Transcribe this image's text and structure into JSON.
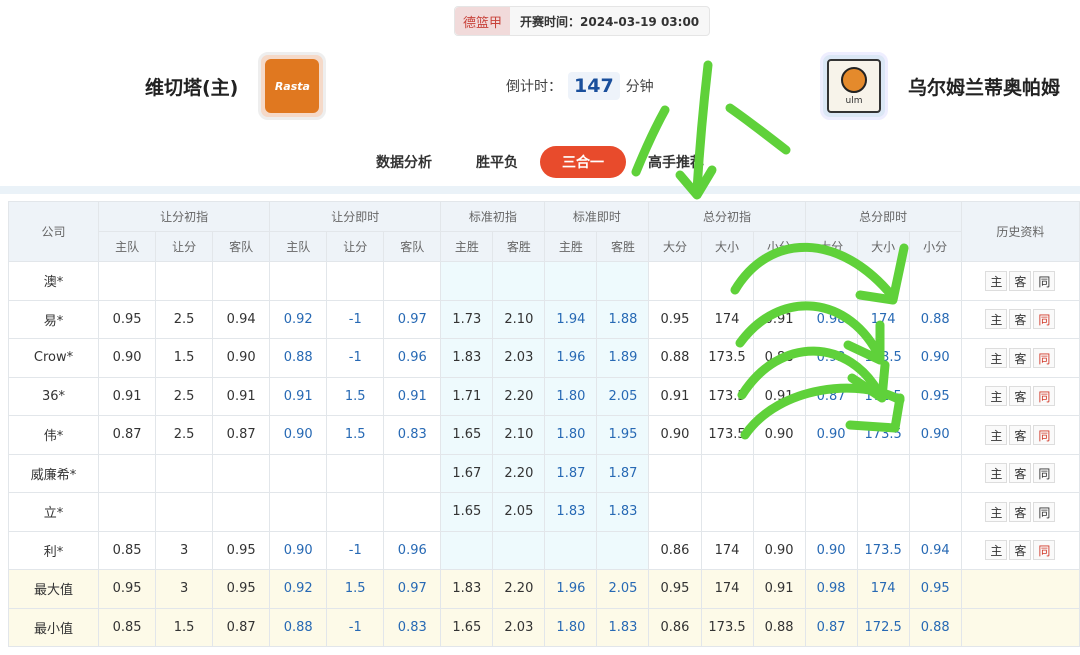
{
  "header": {
    "league": "德篮甲",
    "start_time": "开赛时间：2024-03-19 03:00"
  },
  "home": {
    "name": "维切塔(主)",
    "logo_text": "Rasta"
  },
  "away": {
    "name": "乌尔姆兰蒂奥帕姆",
    "logo_text": "ulm"
  },
  "countdown": {
    "label": "倒计时：",
    "value": "147",
    "unit": "分钟"
  },
  "tabs": [
    "数据分析",
    "胜平负",
    "三合一",
    "高手推荐"
  ],
  "table": {
    "group_headers": [
      "公司",
      "让分初指",
      "让分即时",
      "标准初指",
      "标准即时",
      "总分初指",
      "总分即时",
      "历史资料"
    ],
    "sub_headers": [
      "主队",
      "让分",
      "客队",
      "主队",
      "让分",
      "客队",
      "主胜",
      "客胜",
      "主胜",
      "客胜",
      "大分",
      "大小",
      "小分",
      "大分",
      "大小",
      "小分"
    ],
    "rows": [
      {
        "company": "澳*",
        "v": [
          "",
          "",
          "",
          "",
          "",
          "",
          "",
          "",
          "",
          "",
          "",
          "",
          "",
          "",
          "",
          ""
        ],
        "same_red": false
      },
      {
        "company": "易*",
        "v": [
          "0.95",
          "2.5",
          "0.94",
          "0.92",
          "-1",
          "0.97",
          "1.73",
          "2.10",
          "1.94",
          "1.88",
          "0.95",
          "174",
          "0.91",
          "0.98",
          "174",
          "0.88"
        ],
        "same_red": true
      },
      {
        "company": "Crow*",
        "v": [
          "0.90",
          "1.5",
          "0.90",
          "0.88",
          "-1",
          "0.96",
          "1.83",
          "2.03",
          "1.96",
          "1.89",
          "0.88",
          "173.5",
          "0.88",
          "0.92",
          "173.5",
          "0.90"
        ],
        "same_red": true
      },
      {
        "company": "36*",
        "v": [
          "0.91",
          "2.5",
          "0.91",
          "0.91",
          "1.5",
          "0.91",
          "1.71",
          "2.20",
          "1.80",
          "2.05",
          "0.91",
          "173.5",
          "0.91",
          "0.87",
          "172.5",
          "0.95"
        ],
        "same_red": true
      },
      {
        "company": "伟*",
        "v": [
          "0.87",
          "2.5",
          "0.87",
          "0.90",
          "1.5",
          "0.83",
          "1.65",
          "2.10",
          "1.80",
          "1.95",
          "0.90",
          "173.5",
          "0.90",
          "0.90",
          "173.5",
          "0.90"
        ],
        "same_red": true
      },
      {
        "company": "威廉希*",
        "v": [
          "",
          "",
          "",
          "",
          "",
          "",
          "1.67",
          "2.20",
          "1.87",
          "1.87",
          "",
          "",
          "",
          "",
          "",
          ""
        ],
        "same_red": false
      },
      {
        "company": "立*",
        "v": [
          "",
          "",
          "",
          "",
          "",
          "",
          "1.65",
          "2.05",
          "1.83",
          "1.83",
          "",
          "",
          "",
          "",
          "",
          ""
        ],
        "same_red": false
      },
      {
        "company": "利*",
        "v": [
          "0.85",
          "3",
          "0.95",
          "0.90",
          "-1",
          "0.96",
          "",
          "",
          "",
          "",
          "0.86",
          "174",
          "0.90",
          "0.90",
          "173.5",
          "0.94"
        ],
        "same_red": true
      }
    ],
    "summary": [
      {
        "label": "最大值",
        "v": [
          "0.95",
          "3",
          "0.95",
          "0.92",
          "1.5",
          "0.97",
          "1.83",
          "2.20",
          "1.96",
          "2.05",
          "0.95",
          "174",
          "0.91",
          "0.98",
          "174",
          "0.95"
        ]
      },
      {
        "label": "最小值",
        "v": [
          "0.85",
          "1.5",
          "0.87",
          "0.88",
          "-1",
          "0.83",
          "1.65",
          "2.03",
          "1.80",
          "1.83",
          "0.86",
          "173.5",
          "0.88",
          "0.87",
          "172.5",
          "0.88"
        ]
      }
    ],
    "history_buttons": [
      "主",
      "客",
      "同"
    ]
  },
  "handwriting": {
    "text": "小",
    "color": "#5fd13a"
  }
}
